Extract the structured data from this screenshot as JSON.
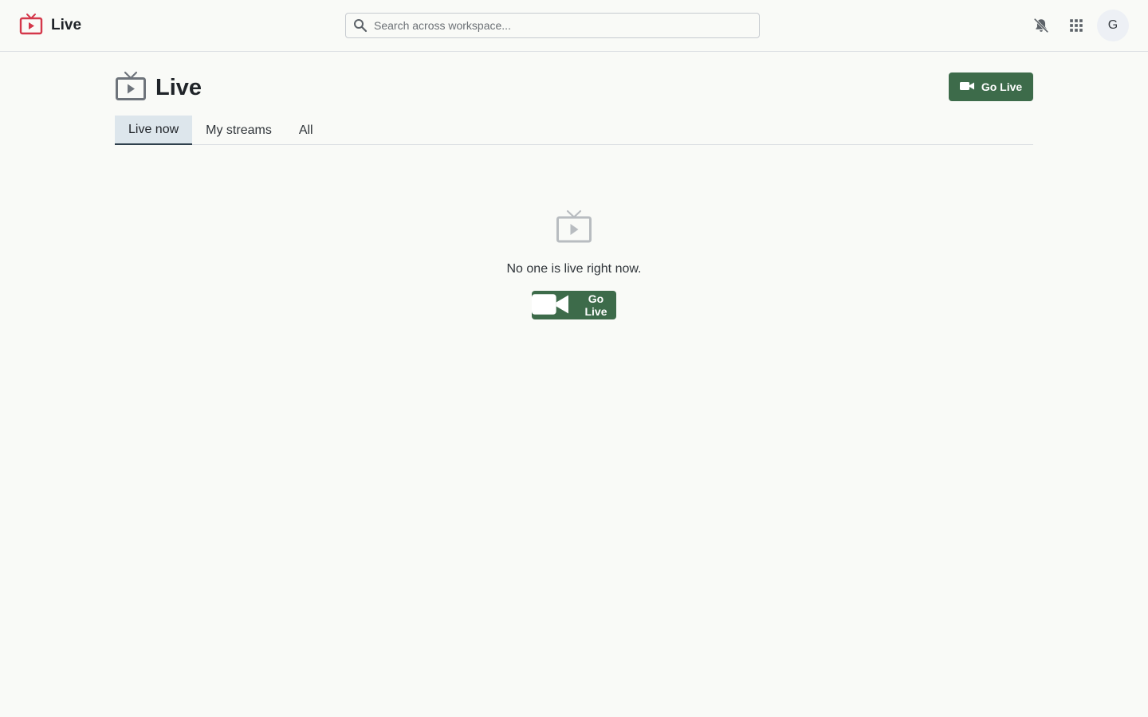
{
  "app": {
    "name": "Live"
  },
  "search": {
    "placeholder": "Search across workspace..."
  },
  "user": {
    "avatar_initial": "G"
  },
  "page": {
    "title": "Live",
    "go_live_label": "Go Live"
  },
  "tabs": [
    {
      "label": "Live now",
      "active": true
    },
    {
      "label": "My streams",
      "active": false
    },
    {
      "label": "All",
      "active": false
    }
  ],
  "empty_state": {
    "message": "No one is live right now.",
    "button_label": "Go Live"
  },
  "icons": {
    "brand": "live-tv-icon",
    "search": "search-icon",
    "notifications": "bell-off-icon",
    "apps": "apps-grid-icon",
    "go_live": "video-camera-icon"
  },
  "colors": {
    "brand_red": "#d4374a",
    "primary_green": "#3d6b4a",
    "icon_gray": "#6e747b",
    "active_tab_bg": "#dde6ec"
  }
}
